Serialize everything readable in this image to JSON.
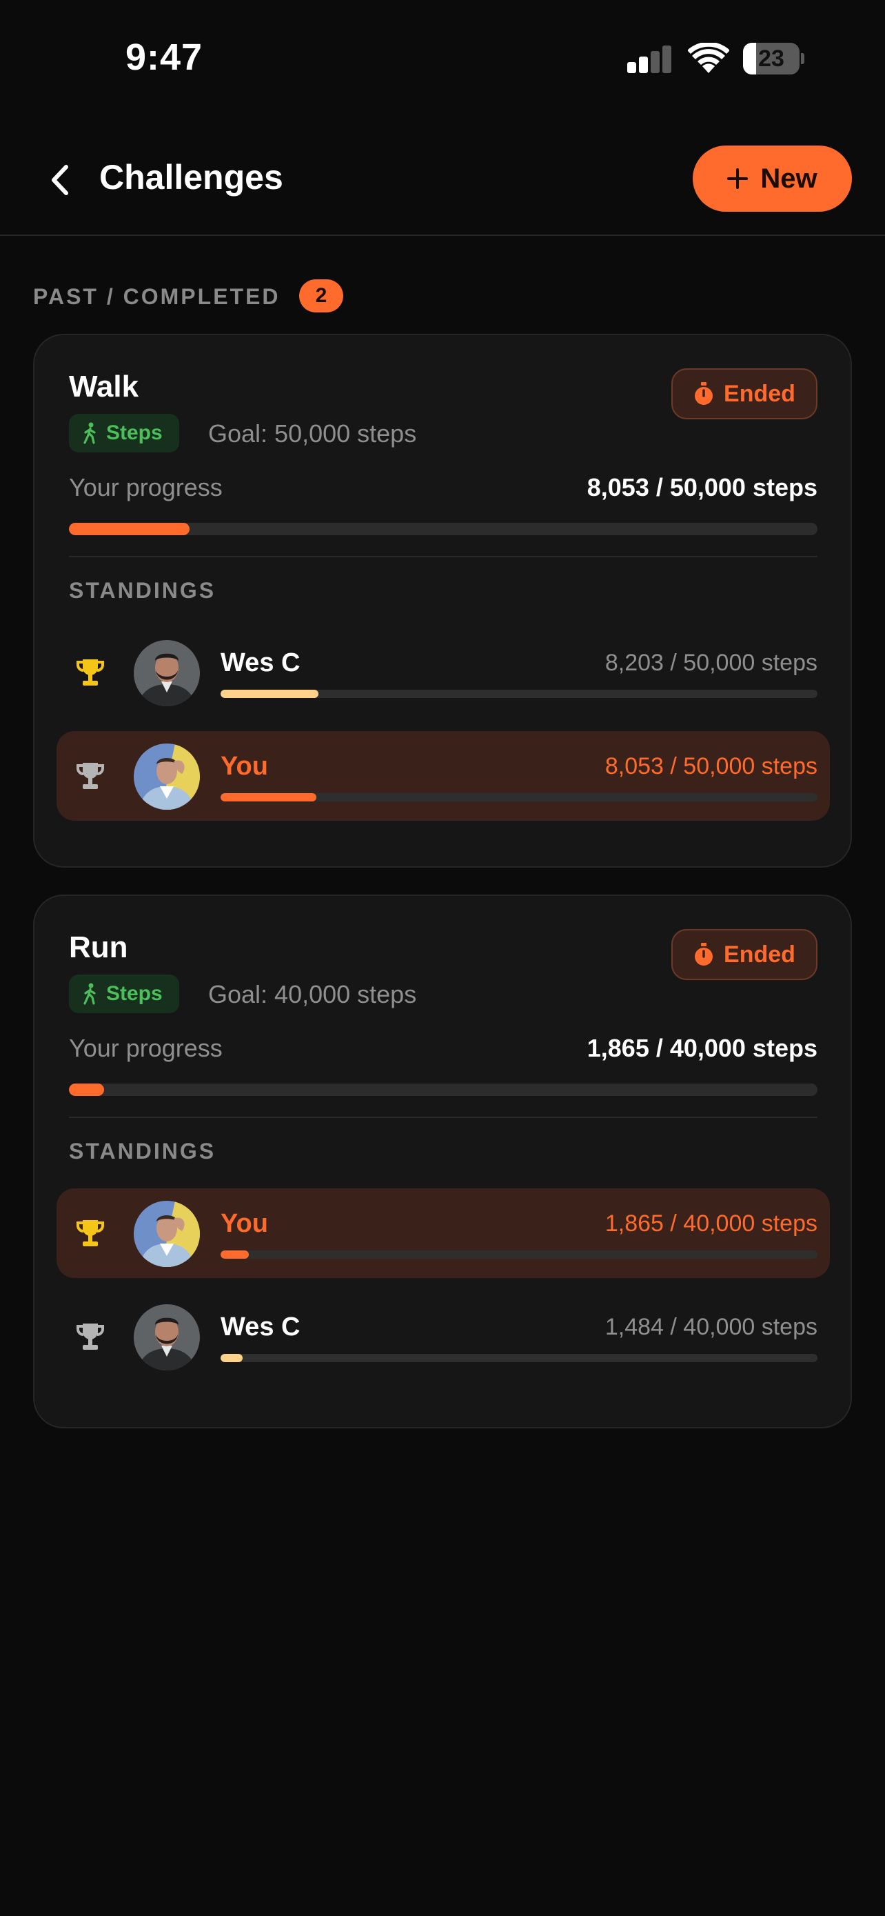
{
  "status_bar": {
    "time": "9:47",
    "battery": "23",
    "battery_level": 0.23
  },
  "header": {
    "title": "Challenges",
    "new_label": "New"
  },
  "section": {
    "label": "PAST / COMPLETED",
    "count": "2"
  },
  "colors": {
    "accent": "#ff6b2c",
    "steps_green": "#4cbe5a",
    "trophy_gold": "#f5c518",
    "trophy_silver": "#b5b5b5",
    "rival_bar": "#ffd28c"
  },
  "challenges": [
    {
      "title": "Walk",
      "status": "Ended",
      "type": "Steps",
      "goal": "Goal: 50,000 steps",
      "progress_label": "Your progress",
      "progress_value": "8,053 / 50,000 steps",
      "progress_ratio": 0.161,
      "standings_label": "STANDINGS",
      "standings": [
        {
          "name": "Wes C",
          "value": "8,203 / 50,000 steps",
          "ratio": 0.164,
          "trophy": "gold",
          "me": false
        },
        {
          "name": "You",
          "value": "8,053 / 50,000 steps",
          "ratio": 0.161,
          "trophy": "silver",
          "me": true
        }
      ]
    },
    {
      "title": "Run",
      "status": "Ended",
      "type": "Steps",
      "goal": "Goal: 40,000 steps",
      "progress_label": "Your progress",
      "progress_value": "1,865 / 40,000 steps",
      "progress_ratio": 0.047,
      "standings_label": "STANDINGS",
      "standings": [
        {
          "name": "You",
          "value": "1,865 / 40,000 steps",
          "ratio": 0.047,
          "trophy": "gold",
          "me": true
        },
        {
          "name": "Wes C",
          "value": "1,484 / 40,000 steps",
          "ratio": 0.037,
          "trophy": "silver",
          "me": false
        }
      ]
    }
  ],
  "icons": {
    "back": "chevron-left-icon",
    "new": "plus-icon",
    "ended": "stopwatch-icon",
    "type": "walking-person-icon",
    "standing": "trophy-icon"
  }
}
